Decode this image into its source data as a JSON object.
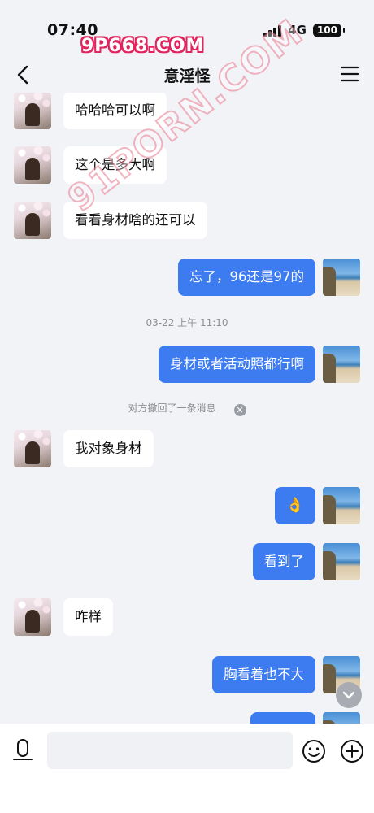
{
  "status_bar": {
    "time": "07:40",
    "network": "4G",
    "battery": "100"
  },
  "watermarks": {
    "top": "9P668.COM",
    "diagonal": "91PORN.COM"
  },
  "nav": {
    "title": "意淫怪",
    "back_icon": "chevron-left-icon",
    "menu_icon": "hamburger-menu-icon"
  },
  "messages": [
    {
      "side": "in",
      "text": "哈哈哈可以啊"
    },
    {
      "side": "in",
      "text": "这个是多大啊"
    },
    {
      "side": "in",
      "text": "看看身材啥的还可以"
    },
    {
      "side": "out",
      "text": "忘了，96还是97的"
    },
    {
      "side": "time",
      "text": "03-22 上午 11:10"
    },
    {
      "side": "out",
      "text": "身材或者活动照都行啊"
    },
    {
      "side": "system",
      "text": "对方撤回了一条消息"
    },
    {
      "side": "in",
      "text": "我对象身材"
    },
    {
      "side": "out",
      "text": "👌"
    },
    {
      "side": "out",
      "text": "看到了"
    },
    {
      "side": "in",
      "text": "咋样"
    },
    {
      "side": "out",
      "text": "胸看着也不大"
    },
    {
      "side": "out",
      "text": ""
    }
  ],
  "input": {
    "placeholder": "",
    "voice_icon": "microphone-icon",
    "emoji_icon": "smiley-icon",
    "plus_icon": "plus-icon"
  },
  "colors": {
    "outgoing_bubble": "#3d7cf0",
    "incoming_bubble": "#ffffff",
    "background": "#f2f3f7"
  }
}
